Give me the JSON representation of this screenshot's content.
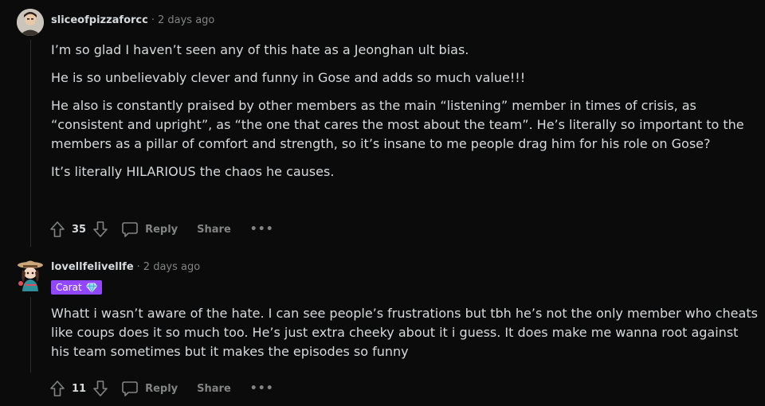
{
  "comments": [
    {
      "username": "sliceofpizzaforcc",
      "time": "2 days ago",
      "paragraphs": [
        "I’m so glad I haven’t seen any of this hate as a Jeonghan ult bias.",
        "He is so unbelievably clever and funny in Gose and adds so much value!!!",
        "He also is constantly praised by other members as the main “listening” member in times of crisis, as “consistent and upright”, as “the one that cares the most about the team”. He’s literally so important to the members as a pillar of comfort and strength, so it’s insane to me people drag him for his role on Gose?",
        "It’s literally HILARIOUS the chaos he causes."
      ],
      "score": "35",
      "reply_label": "Reply",
      "share_label": "Share",
      "more_label": "•••"
    },
    {
      "username": "lovellfelivellfe",
      "time": "2 days ago",
      "flair": "Carat",
      "paragraphs": [
        "Whatt i wasn’t aware of the hate. I can see people’s frustrations but tbh he’s not the only member who cheats like coups does it so much too. He’s just extra cheeky about it i guess. It does make me wanna root against his team sometimes but it makes the episodes so funny"
      ],
      "score": "11",
      "reply_label": "Reply",
      "share_label": "Share",
      "more_label": "•••"
    }
  ],
  "colors": {
    "background": "#0b0b0b",
    "text": "#d7dadc",
    "muted": "#818384",
    "flair_bg": "#9146ff"
  },
  "icons": [
    "upvote-icon",
    "downvote-icon",
    "comment-icon",
    "diamond-icon"
  ]
}
